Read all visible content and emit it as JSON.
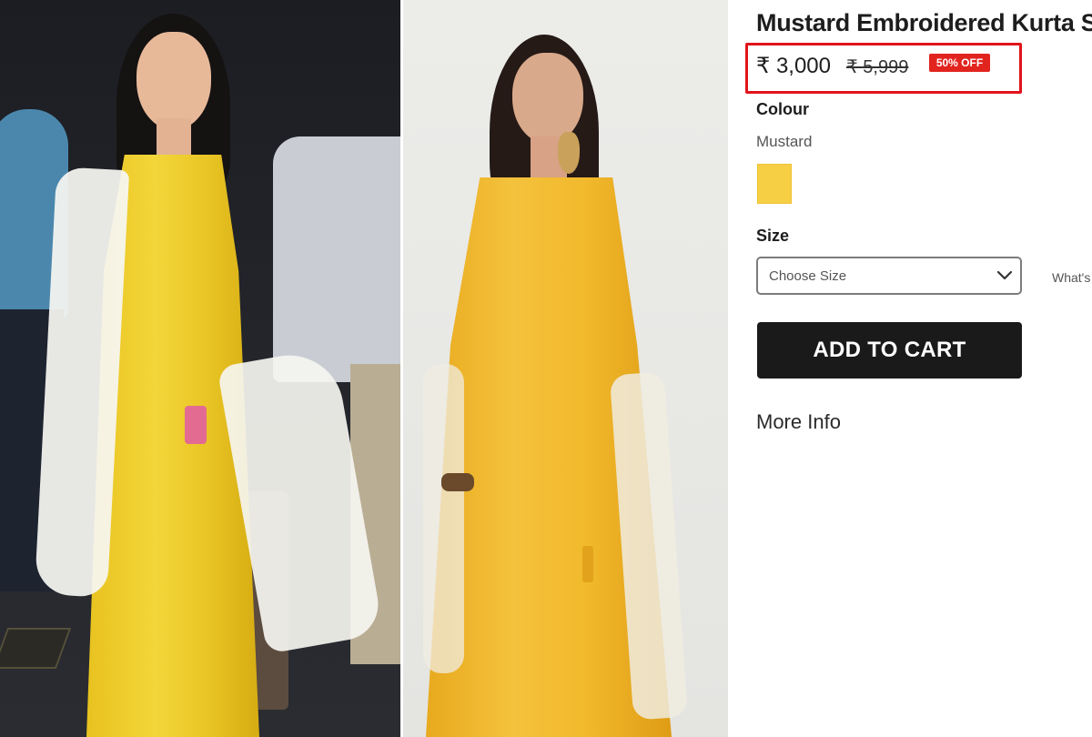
{
  "product": {
    "title": "Mustard Embroidered Kurta Set",
    "price": "₹ 3,000",
    "mrp": "₹ 5,999",
    "discount": "50% OFF"
  },
  "colour": {
    "label": "Colour",
    "value": "Mustard",
    "swatch_hex": "#f6cf45"
  },
  "size": {
    "label": "Size",
    "placeholder": "Choose Size",
    "guide_link": "What's"
  },
  "actions": {
    "add_to_cart": "ADD TO CART",
    "more_info": "More Info"
  },
  "colors": {
    "highlight_border": "#e2131b",
    "badge_bg": "#e2241f",
    "button_bg": "#1a1a1a"
  },
  "images": {
    "left": "celebrity-in-mustard-kurta-photo",
    "middle": "model-in-mustard-kurta-photo"
  }
}
